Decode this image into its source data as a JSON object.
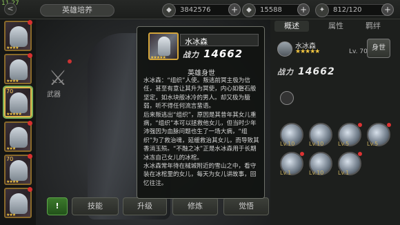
{
  "topbar": {
    "level_tag": "11 27",
    "back_label": "<",
    "title": "英雄培养",
    "resources": [
      {
        "icon": "diamond-icon",
        "glyph": "◆",
        "value": "3842576",
        "plus": "+"
      },
      {
        "icon": "gem-icon",
        "glyph": "◆",
        "value": "15588",
        "plus": "+"
      },
      {
        "icon": "stamina-icon",
        "glyph": "✦",
        "value": "812/120",
        "plus": "+"
      }
    ]
  },
  "hero_list": [
    {
      "level": "",
      "stars": "★★★★",
      "selected": false
    },
    {
      "level": "",
      "stars": "★★★★",
      "selected": false
    },
    {
      "level": "70",
      "stars": "★★★★★",
      "selected": true
    },
    {
      "level": "",
      "stars": "★★★",
      "selected": false
    },
    {
      "level": "70",
      "stars": "★★★★",
      "selected": false
    },
    {
      "level": "",
      "stars": "★★★",
      "selected": false
    }
  ],
  "stage": {
    "weapon_label": "武器"
  },
  "bottom_buttons": {
    "excl": "!",
    "skill": "技能",
    "upgrade": "升级",
    "train": "修炼",
    "awaken": "觉悟"
  },
  "right_panel": {
    "tabs": [
      "概述",
      "属性",
      "羁绊"
    ],
    "hero_name": "水冰森",
    "stars": "★★★★★",
    "level": "Lv. 70",
    "side_button": "身世",
    "power_label": "战力",
    "power_value": "14662",
    "skills": [
      {
        "lv": "Lv.10"
      },
      {
        "lv": "Lv.10"
      },
      {
        "lv": "Lv.5"
      },
      {
        "lv": "Lv.5"
      },
      {
        "lv": "Lv.1"
      },
      {
        "lv": "Lv.10"
      },
      {
        "lv": "Lv.1"
      }
    ]
  },
  "popup": {
    "hero_name": "水冰森",
    "stars": "★★★★★",
    "power_label": "战力",
    "power_value": "14662",
    "section_title": "英雄身世",
    "paragraphs": [
      "水冰森：“组织”人使。叛逃前冥主极为信任，甚至有意让其升为冥使，内心如磐石般坚定，如水块般冰冷的男人。却又极为臆弱，听不得任何流言蜚语。",
      "后来叛逃出“组织”，原因是其昔年其女儿重病，“组织”本可以拯救他女儿，但当时少年沛强因为血脉问题也生了一场大病，“组织”为了救治魂，延缓救治其女儿，而导致其香消玉殒。“不融之冰”正是水冰森用于长期冰冻自己女儿的冰棺。",
      "水冰森常年待在械城附近的雪山之中，看守装在冰棺里的女儿，每天为女儿讲故事，回忆往注。"
    ]
  }
}
